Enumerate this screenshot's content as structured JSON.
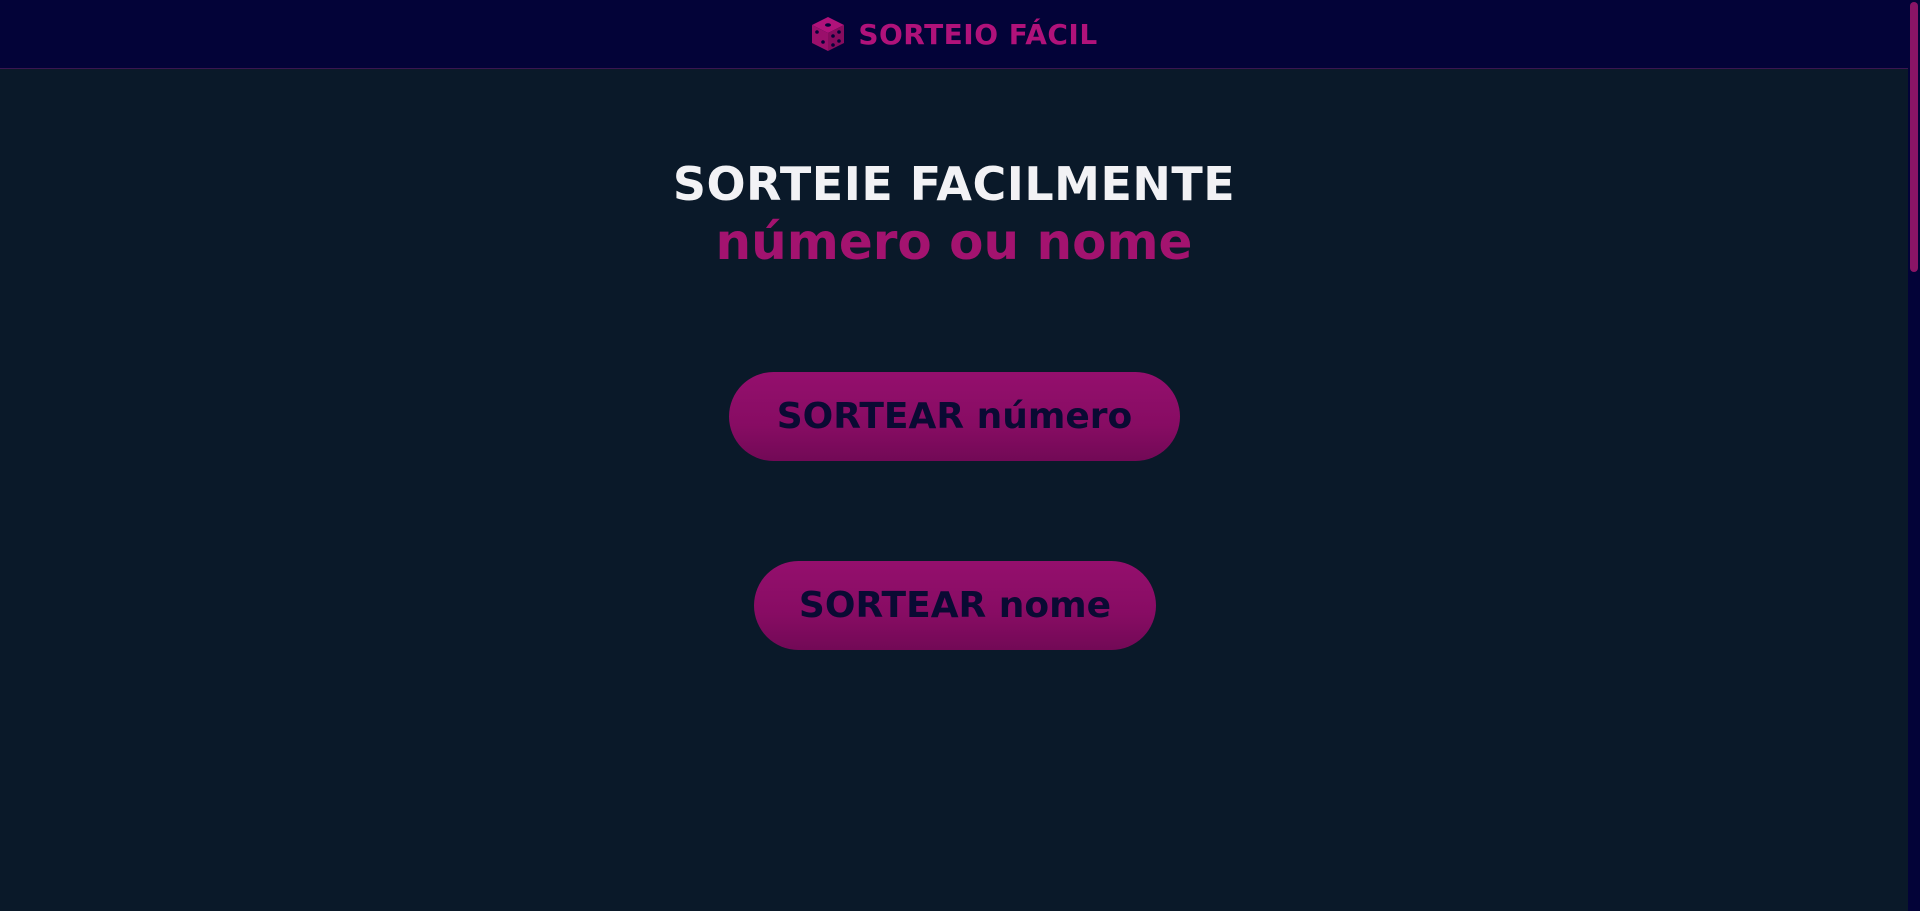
{
  "header": {
    "brand_icon": "dice-icon",
    "brand_text": "SORTEIO FÁCIL"
  },
  "hero": {
    "line1": "SORTEIE FACILMENTE",
    "line2": "número ou nome"
  },
  "actions": {
    "sortear_numero_label": "SORTEAR número",
    "sortear_nome_label": "SORTEAR nome"
  },
  "colors": {
    "background": "#0a1929",
    "header_background": "#030338",
    "accent": "#a3136f",
    "button_text": "#0a0a33",
    "headline_text": "#f2f2f5"
  }
}
